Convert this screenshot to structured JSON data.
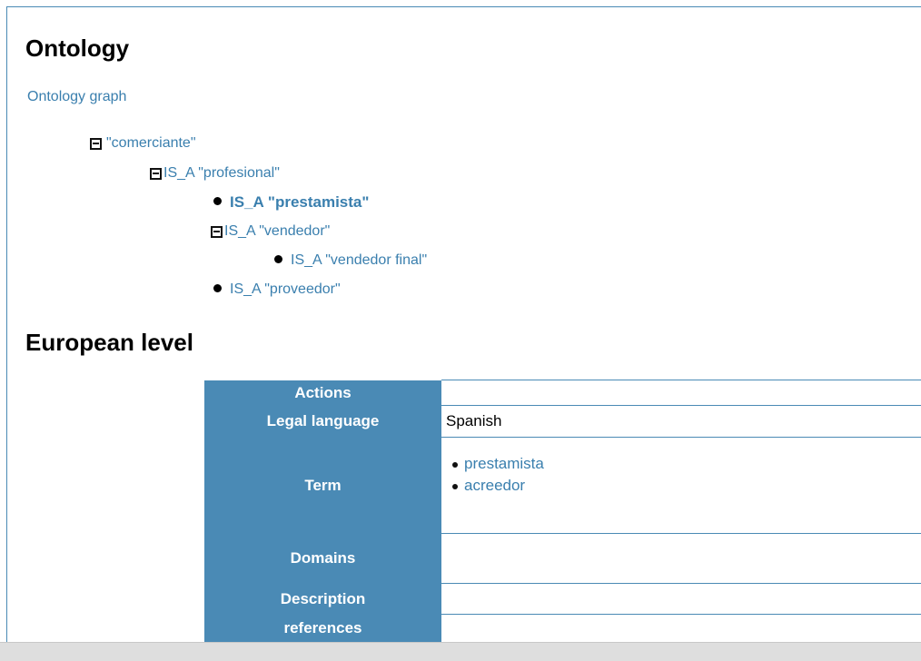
{
  "ontology": {
    "title": "Ontology",
    "graph_link": "Ontology graph",
    "tree": [
      {
        "label": "\"comerciante\"",
        "node": "toggle",
        "level": 0
      },
      {
        "label": "IS_A \"profesional\"",
        "node": "toggle",
        "level": 1
      },
      {
        "label": "IS_A \"prestamista\"",
        "node": "bullet",
        "level": 2,
        "bold": true
      },
      {
        "label": "IS_A \"vendedor\"",
        "node": "toggle",
        "level": 2
      },
      {
        "label": "IS_A \"vendedor final\"",
        "node": "bullet",
        "level": 3
      },
      {
        "label": "IS_A \"proveedor\"",
        "node": "bullet",
        "level": 2
      }
    ]
  },
  "european": {
    "title": "European level",
    "rows": {
      "actions": {
        "label": "Actions",
        "value": ""
      },
      "legal_language": {
        "label": "Legal language",
        "value": "Spanish"
      },
      "term": {
        "label": "Term",
        "values": [
          "prestamista",
          "acreedor"
        ]
      },
      "domains": {
        "label": "Domains",
        "value": ""
      },
      "description": {
        "label": "Description",
        "value": ""
      },
      "references": {
        "label": "references",
        "value": ""
      }
    }
  },
  "colors": {
    "accent": "#4a8ab5",
    "link": "#3a7fae"
  }
}
